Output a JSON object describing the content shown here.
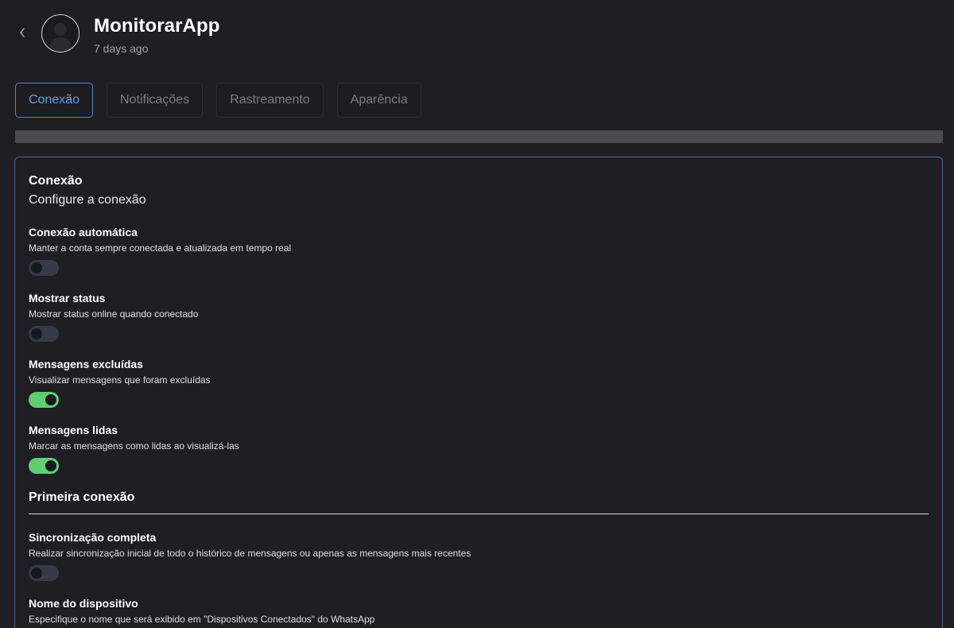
{
  "header": {
    "title": "MonitorarApp",
    "subtitle": "7 days ago"
  },
  "tabs": [
    {
      "label": "Conexão",
      "active": true
    },
    {
      "label": "Notificações",
      "active": false
    },
    {
      "label": "Rastreamento",
      "active": false
    },
    {
      "label": "Aparência",
      "active": false
    }
  ],
  "progress": {
    "value": 1.0
  },
  "card": {
    "title": "Conexão",
    "subtitle": "Configure a conexão",
    "settings": [
      {
        "title": "Conexão automática",
        "description": "Manter a conta sempre conectada e atualizada em tempo real",
        "enabled": false
      },
      {
        "title": "Mostrar status",
        "description": "Mostrar status online quando conectado",
        "enabled": false
      },
      {
        "title": "Mensagens excluídas",
        "description": "Visualizar mensagens que foram excluídas",
        "enabled": true
      },
      {
        "title": "Mensagens lidas",
        "description": "Marcar as mensagens como lidas ao visualizá-las",
        "enabled": true
      }
    ],
    "section": {
      "heading": "Primeira conexão",
      "settings": [
        {
          "title": "Sincronização completa",
          "description": "Realizar sincronização inicial de todo o histórico de mensagens ou apenas as mensagens mais recentes",
          "enabled": false
        },
        {
          "title": "Nome do dispositivo",
          "description": "Especifique o nome que será exibido em \"Dispositivos Conectados\" do WhatsApp"
        }
      ]
    }
  },
  "icons": {
    "back": "chevron-left-icon",
    "avatar": "user-silhouette-icon"
  },
  "colors": {
    "background": "#1e1e23",
    "accent": "#6a9de6",
    "card_border": "#4c6898",
    "toggle_on": "#5fcf72",
    "toggle_off": "#353b48"
  }
}
